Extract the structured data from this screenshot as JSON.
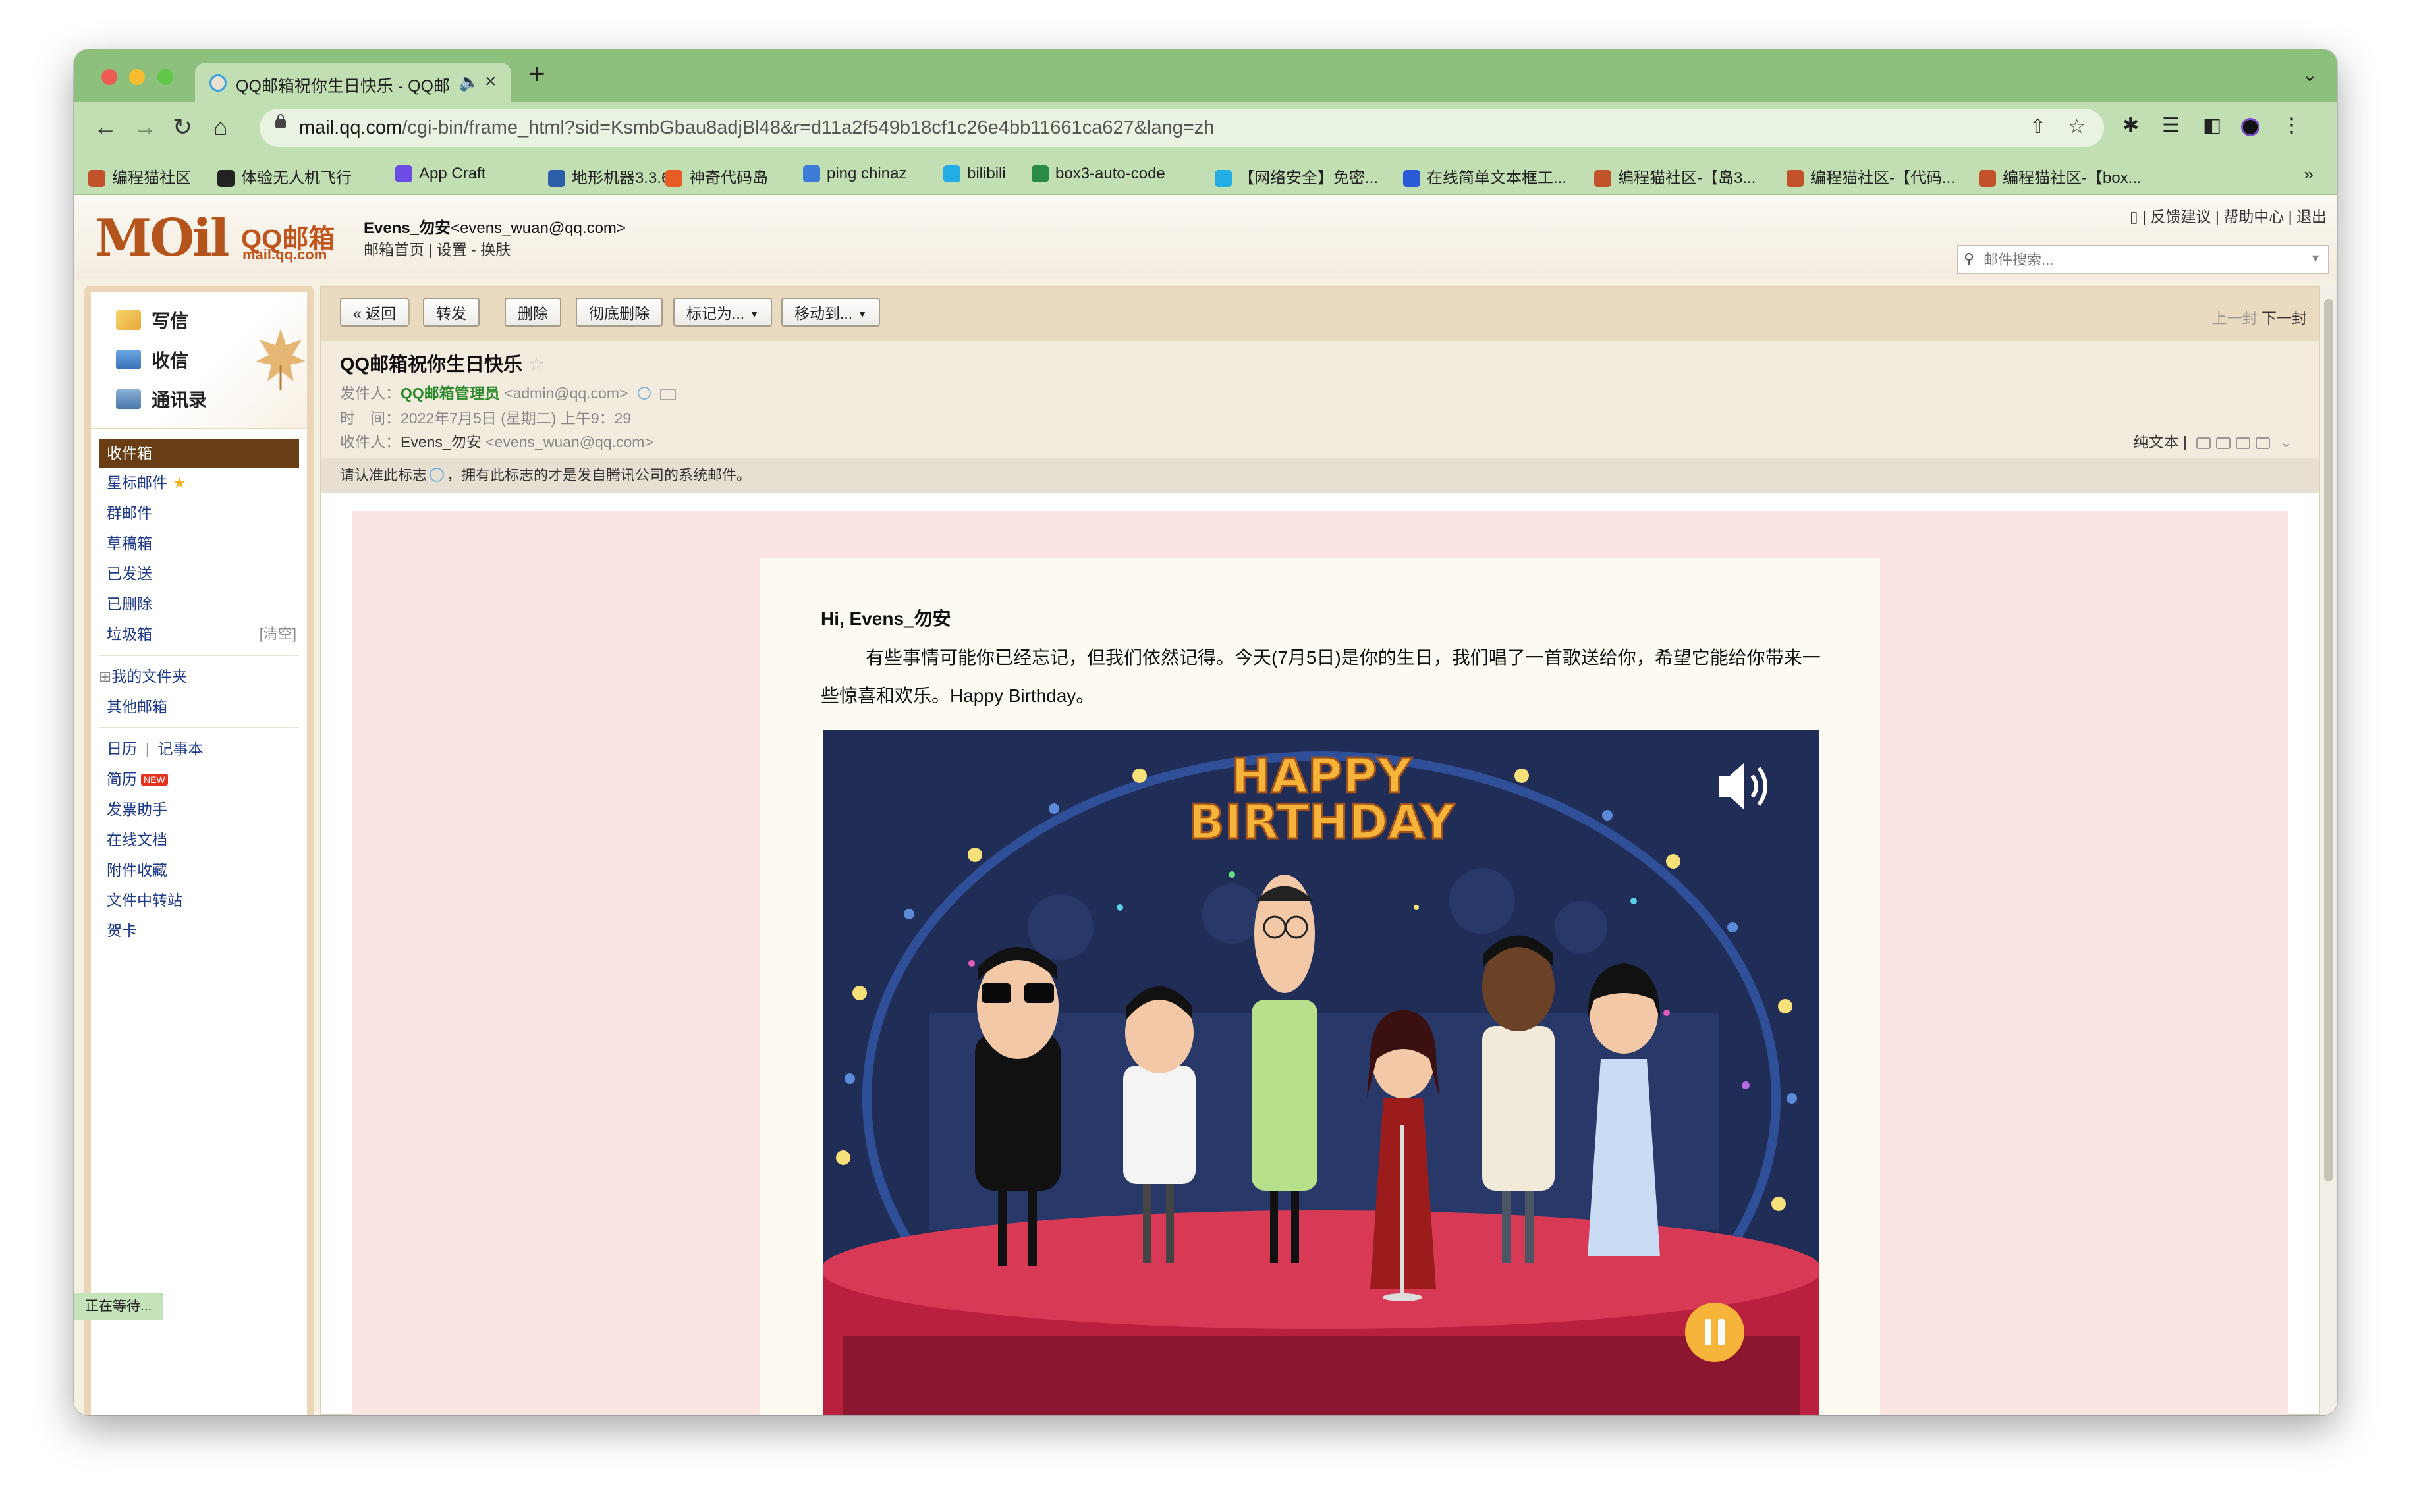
{
  "browser": {
    "tab_title": "QQ邮箱祝你生日快乐 - QQ邮",
    "url_host": "mail.qq.com",
    "url_path": "/cgi-bin/frame_html?sid=KsmbGbau8adjBl48&r=d11a2f549b18cf1c26e4bb11661ca627&lang=zh",
    "bookmarks": [
      {
        "label": "编程猫社区",
        "color": "#c2522a"
      },
      {
        "label": "体验无人机飞行",
        "color": "#222222"
      },
      {
        "label": "App Craft",
        "color": "#6b4de6"
      },
      {
        "label": "地形机器3.3.6",
        "color": "#2d5fa8"
      },
      {
        "label": "神奇代码岛",
        "color": "#e85b25"
      },
      {
        "label": "ping chinaz",
        "color": "#3d7dd8"
      },
      {
        "label": "bilibili",
        "color": "#23ade5"
      },
      {
        "label": "box3-auto-code",
        "color": "#2a8a4a"
      },
      {
        "label": "【网络安全】免密...",
        "color": "#23ade5"
      },
      {
        "label": "在线简单文本框工...",
        "color": "#2a5bd7"
      },
      {
        "label": "编程猫社区-【岛3...",
        "color": "#c2522a"
      },
      {
        "label": "编程猫社区-【代码...",
        "color": "#c2522a"
      },
      {
        "label": "编程猫社区-【box...",
        "color": "#c2522a"
      }
    ],
    "status_text": "正在等待..."
  },
  "header": {
    "logo_text": "MOil",
    "logo_qq": "QQ邮箱",
    "logo_domain": "mail.qq.com",
    "user_name": "Evens_勿安",
    "user_email": "<evens_wuan@qq.com>",
    "links": [
      "邮箱首页",
      "设置",
      "换肤"
    ],
    "top_links": [
      "反馈建议",
      "帮助中心",
      "退出"
    ],
    "search_placeholder": "邮件搜索..."
  },
  "sidebar": {
    "quick": [
      "写信",
      "收信",
      "通讯录"
    ],
    "folders_main": [
      {
        "label": "收件箱",
        "active": true
      },
      {
        "label": "星标邮件",
        "star": true
      },
      {
        "label": "群邮件"
      },
      {
        "label": "草稿箱"
      },
      {
        "label": "已发送"
      },
      {
        "label": "已删除"
      },
      {
        "label": "垃圾箱",
        "right": "[清空]"
      }
    ],
    "folders_mine": [
      "我的文件夹",
      "其他邮箱"
    ],
    "apps_calendar": "日历",
    "apps_notes": "记事本",
    "apps": [
      {
        "label": "简历",
        "badge": "NEW"
      },
      {
        "label": "发票助手"
      },
      {
        "label": "在线文档"
      },
      {
        "label": "附件收藏"
      },
      {
        "label": "文件中转站"
      },
      {
        "label": "贺卡"
      }
    ]
  },
  "mail_toolbar": {
    "back": "« 返回",
    "forward": "转发",
    "delete": "删除",
    "delete_forever": "彻底删除",
    "mark_as": "标记为...",
    "move_to": "移动到...",
    "prev": "上一封",
    "next": "下一封"
  },
  "mail": {
    "subject": "QQ邮箱祝你生日快乐",
    "from_label": "发件人：",
    "from_name": "QQ邮箱管理员",
    "from_email": "<admin@qq.com>",
    "time_label": "时　间：",
    "time_value": "2022年7月5日 (星期二) 上午9：29",
    "to_label": "收件人：",
    "to_name": "Evens_勿安",
    "to_email": "<evens_wuan@qq.com>",
    "plain_text": "纯文本",
    "notice_pre": "请认准此标志",
    "notice_post": "，拥有此标志的才是发自腾讯公司的系统邮件。",
    "greeting": "Hi, Evens_勿安",
    "paragraph": "有些事情可能你已经忘记，但我们依然记得。今天(7月5日)是你的生日，我们唱了一首歌送给你，希望它能给你带来一些惊喜和欢乐。Happy Birthday。",
    "video_title_1": "HAPPY",
    "video_title_2": "BIRTHDAY"
  }
}
